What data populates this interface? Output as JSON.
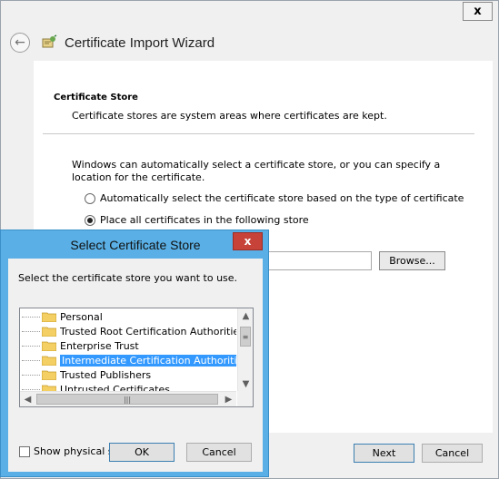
{
  "wizard": {
    "title": "Certificate Import Wizard",
    "close_glyph": "x",
    "back_glyph": "←",
    "section_title": "Certificate Store",
    "section_desc": "Certificate stores are system areas where certificates are kept.",
    "intro": "Windows can automatically select a certificate store, or you can specify a location for the certificate.",
    "options": [
      {
        "label": "Automatically select the certificate store based on the type of certificate",
        "selected": false
      },
      {
        "label": "Place all certificates in the following store",
        "selected": true
      }
    ],
    "store_value": "",
    "browse_label": "Browse...",
    "next_label": "Next",
    "cancel_label": "Cancel"
  },
  "dialog": {
    "title": "Select Certificate Store",
    "close_glyph": "x",
    "prompt": "Select the certificate store you want to use.",
    "stores": [
      {
        "label": "Personal",
        "selected": false
      },
      {
        "label": "Trusted Root Certification Authorities",
        "selected": false
      },
      {
        "label": "Enterprise Trust",
        "selected": false
      },
      {
        "label": "Intermediate Certification Authorities",
        "selected": true
      },
      {
        "label": "Trusted Publishers",
        "selected": false
      },
      {
        "label": "Untrusted Certificates",
        "selected": false
      }
    ],
    "show_physical_label": "Show physical stores",
    "show_physical_checked": false,
    "ok_label": "OK",
    "cancel_label": "Cancel"
  },
  "colors": {
    "dialog_frame": "#5ab0e6",
    "selection": "#3399ff",
    "close_red": "#c7433a"
  }
}
